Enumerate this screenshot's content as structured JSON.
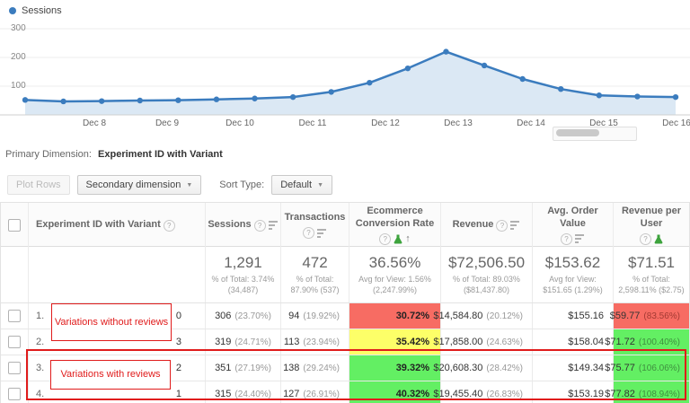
{
  "chart_data": {
    "type": "line",
    "legend": "Sessions",
    "x_labels": [
      "Dec 8",
      "Dec 9",
      "Dec 10",
      "Dec 11",
      "Dec 12",
      "Dec 13",
      "Dec 14",
      "Dec 15",
      "Dec 16"
    ],
    "series": [
      {
        "name": "Sessions",
        "values": [
          52,
          47,
          48,
          50,
          51,
          54,
          57,
          62,
          80,
          112,
          162,
          220,
          172,
          125,
          90,
          68,
          64,
          62
        ]
      }
    ],
    "ylim": [
      0,
      300
    ],
    "y_ticks": [
      100,
      200,
      300
    ],
    "y_tick_labels": [
      "300",
      "200",
      "100"
    ],
    "line_color": "#3b7cbe",
    "area_color": "#dbe8f4",
    "grid": "on",
    "legend_position": "top-left"
  },
  "primary_dimension": {
    "label": "Primary Dimension:",
    "value": "Experiment ID with Variant"
  },
  "toolbar": {
    "plot_rows": "Plot Rows",
    "secondary_dimension": "Secondary dimension",
    "sort_type_label": "Sort Type:",
    "sort_type_value": "Default"
  },
  "table": {
    "columns": [
      {
        "label": "Experiment ID with Variant"
      },
      {
        "label": "Sessions"
      },
      {
        "label": "Transactions"
      },
      {
        "label": "Ecommerce Conversion Rate",
        "sorted": "asc"
      },
      {
        "label": "Revenue"
      },
      {
        "label": "Avg. Order Value"
      },
      {
        "label": "Revenue per User"
      }
    ],
    "summary": {
      "sessions": {
        "value": "1,291",
        "sub": "% of Total: 3.74% (34,487)"
      },
      "transactions": {
        "value": "472",
        "sub": "% of Total: 87.90% (537)"
      },
      "conversion_rate": {
        "value": "36.56%",
        "sub": "Avg for View: 1.56% (2,247.99%)"
      },
      "revenue": {
        "value": "$72,506.50",
        "sub": "% of Total: 89.03% ($81,437.80)"
      },
      "avg_order_value": {
        "value": "$153.62",
        "sub": "Avg for View: $151.65 (1.29%)"
      },
      "revenue_per_user": {
        "value": "$71.51",
        "sub": "% of Total: 2,598.11% ($2.75)"
      }
    },
    "rows": [
      {
        "index": "1.",
        "variant": "0",
        "sessions": "306",
        "sessions_pct": "(23.70%)",
        "transactions": "94",
        "transactions_pct": "(19.92%)",
        "conv_rate": "30.72%",
        "conv_class": "red",
        "revenue": "$14,584.80",
        "revenue_pct": "(20.12%)",
        "aov": "$155.16",
        "rpu": "$59.77",
        "rpu_pct": "(83.56%)",
        "rpu_class": "red"
      },
      {
        "index": "2.",
        "variant": "3",
        "sessions": "319",
        "sessions_pct": "(24.71%)",
        "transactions": "113",
        "transactions_pct": "(23.94%)",
        "conv_rate": "35.42%",
        "conv_class": "yellow",
        "revenue": "$17,858.00",
        "revenue_pct": "(24.63%)",
        "aov": "$158.04",
        "rpu": "$71.72",
        "rpu_pct": "(100.40%)",
        "rpu_class": "green"
      },
      {
        "index": "3.",
        "variant": "2",
        "sessions": "351",
        "sessions_pct": "(27.19%)",
        "transactions": "138",
        "transactions_pct": "(29.24%)",
        "conv_rate": "39.32%",
        "conv_class": "green",
        "revenue": "$20,608.30",
        "revenue_pct": "(28.42%)",
        "aov": "$149.34",
        "rpu": "$75.77",
        "rpu_pct": "(106.06%)",
        "rpu_class": "green"
      },
      {
        "index": "4.",
        "variant": "1",
        "sessions": "315",
        "sessions_pct": "(24.40%)",
        "transactions": "127",
        "transactions_pct": "(26.91%)",
        "conv_rate": "40.32%",
        "conv_class": "green",
        "revenue": "$19,455.40",
        "revenue_pct": "(26.83%)",
        "aov": "$153.19",
        "rpu": "$77.82",
        "rpu_pct": "(108.94%)",
        "rpu_class": "green"
      }
    ]
  },
  "annotations": {
    "without": "Variations without reviews",
    "with": "Variations with reviews",
    "accent_color": "#e01b1b"
  }
}
